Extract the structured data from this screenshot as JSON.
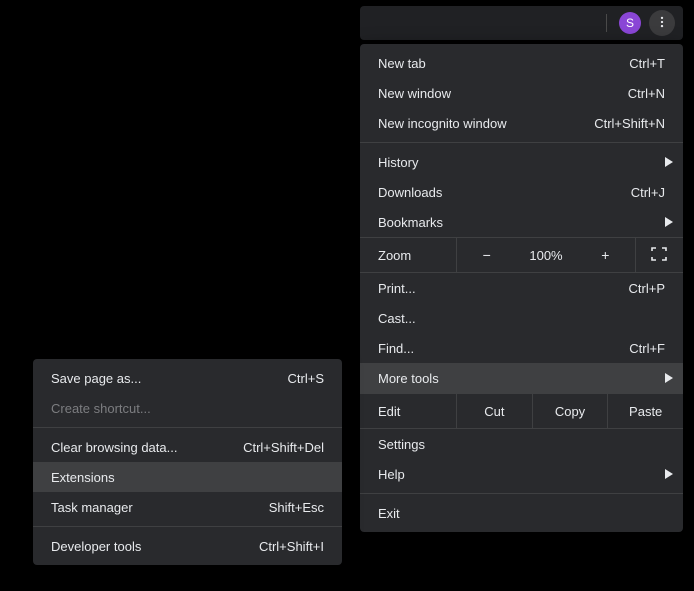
{
  "toolbar": {
    "avatar_letter": "S"
  },
  "menu": {
    "new_tab": {
      "label": "New tab",
      "shortcut": "Ctrl+T"
    },
    "new_window": {
      "label": "New window",
      "shortcut": "Ctrl+N"
    },
    "new_incognito": {
      "label": "New incognito window",
      "shortcut": "Ctrl+Shift+N"
    },
    "history": {
      "label": "History"
    },
    "downloads": {
      "label": "Downloads",
      "shortcut": "Ctrl+J"
    },
    "bookmarks": {
      "label": "Bookmarks"
    },
    "zoom": {
      "label": "Zoom",
      "value": "100%",
      "minus": "−",
      "plus": "+"
    },
    "print": {
      "label": "Print...",
      "shortcut": "Ctrl+P"
    },
    "cast": {
      "label": "Cast..."
    },
    "find": {
      "label": "Find...",
      "shortcut": "Ctrl+F"
    },
    "more_tools": {
      "label": "More tools"
    },
    "edit": {
      "label": "Edit",
      "cut": "Cut",
      "copy": "Copy",
      "paste": "Paste"
    },
    "settings": {
      "label": "Settings"
    },
    "help": {
      "label": "Help"
    },
    "exit": {
      "label": "Exit"
    }
  },
  "submenu": {
    "save_page": {
      "label": "Save page as...",
      "shortcut": "Ctrl+S"
    },
    "create_shortcut": {
      "label": "Create shortcut..."
    },
    "clear_data": {
      "label": "Clear browsing data...",
      "shortcut": "Ctrl+Shift+Del"
    },
    "extensions": {
      "label": "Extensions"
    },
    "task_manager": {
      "label": "Task manager",
      "shortcut": "Shift+Esc"
    },
    "dev_tools": {
      "label": "Developer tools",
      "shortcut": "Ctrl+Shift+I"
    }
  }
}
